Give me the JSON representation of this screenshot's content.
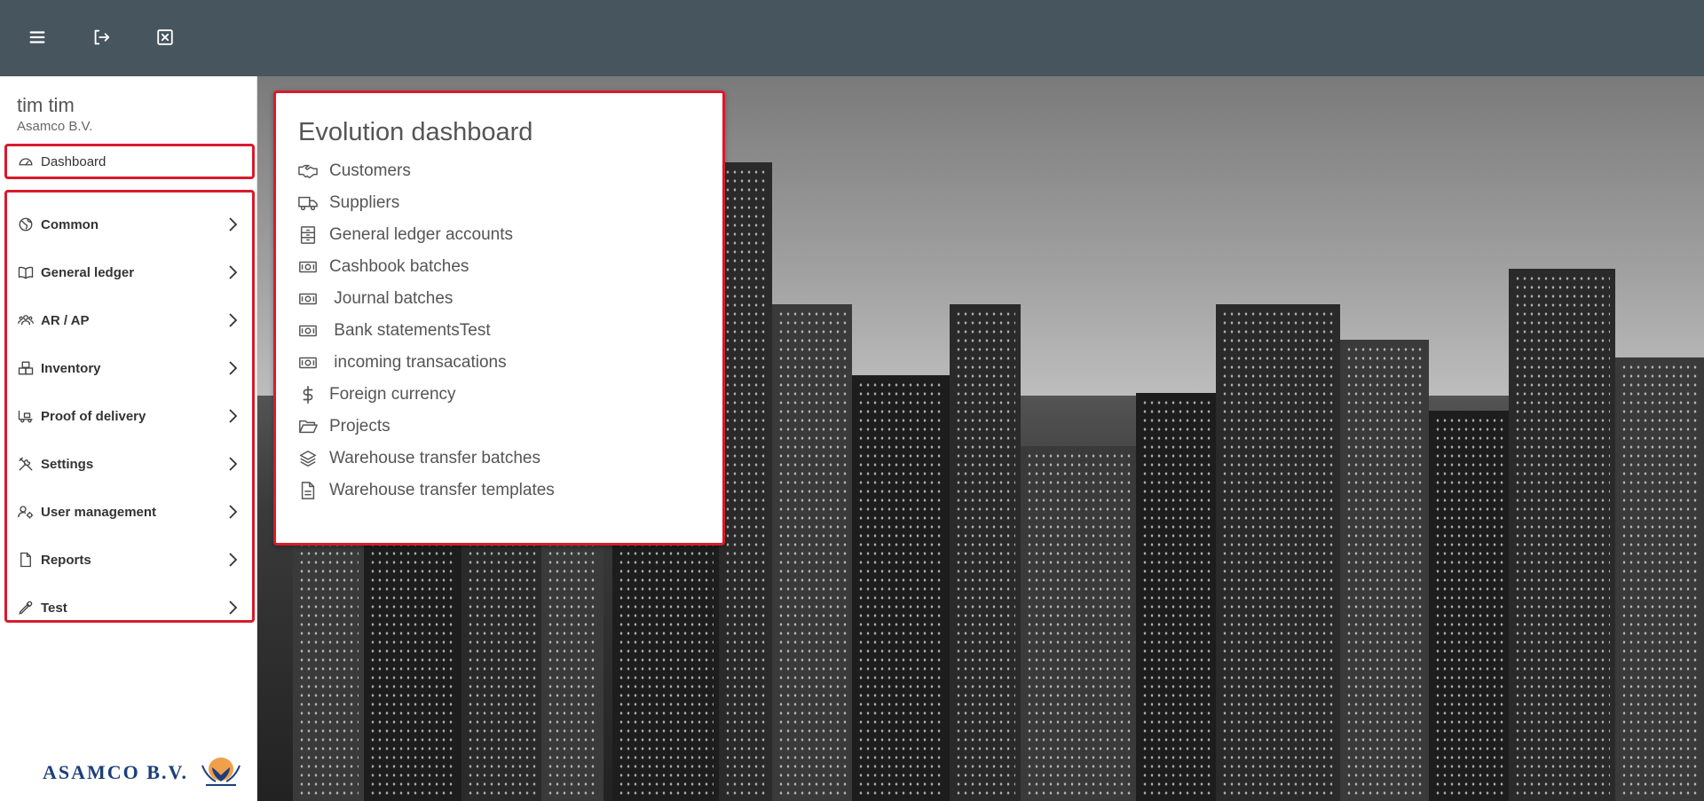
{
  "topbar": {
    "icons": [
      "menu-icon",
      "logout-icon",
      "close-window-icon"
    ]
  },
  "user": {
    "name": "tim tim",
    "company": "Asamco B.V."
  },
  "sidebar": {
    "dashboard_label": "Dashboard",
    "items": [
      {
        "label": "Common",
        "icon": "globe-icon"
      },
      {
        "label": "General ledger",
        "icon": "book-icon"
      },
      {
        "label": "AR / AP",
        "icon": "users-icon"
      },
      {
        "label": "Inventory",
        "icon": "boxes-icon"
      },
      {
        "label": "Proof of delivery",
        "icon": "delivery-icon"
      },
      {
        "label": "Settings",
        "icon": "tools-icon"
      },
      {
        "label": "User management",
        "icon": "user-cog-icon"
      },
      {
        "label": "Reports",
        "icon": "file-icon"
      },
      {
        "label": "Test",
        "icon": "eyedropper-icon"
      }
    ]
  },
  "logo": {
    "text": "ASAMCO B.V."
  },
  "dashboard": {
    "title": "Evolution dashboard",
    "links": [
      {
        "label": "Customers",
        "icon": "handshake-icon"
      },
      {
        "label": "Suppliers",
        "icon": "truck-icon"
      },
      {
        "label": "General ledger accounts",
        "icon": "archive-icon"
      },
      {
        "label": "Cashbook batches",
        "icon": "money-bill-icon"
      },
      {
        "label": " Journal batches",
        "icon": "money-bill-icon"
      },
      {
        "label": " Bank statementsTest",
        "icon": "money-bill-icon"
      },
      {
        "label": " incoming transacations",
        "icon": "money-bill-icon"
      },
      {
        "label": "Foreign currency",
        "icon": "dollar-icon"
      },
      {
        "label": "Projects",
        "icon": "folder-open-icon"
      },
      {
        "label": "Warehouse transfer batches",
        "icon": "layers-icon"
      },
      {
        "label": "Warehouse transfer templates",
        "icon": "document-icon"
      }
    ]
  },
  "colors": {
    "topbar": "#47555f",
    "highlight": "#d81b2b",
    "logo": "#1c3f7a"
  }
}
